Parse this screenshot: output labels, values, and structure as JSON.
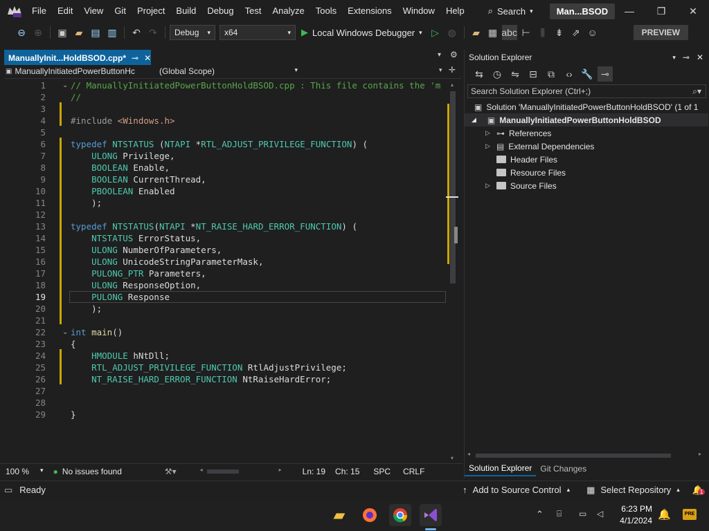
{
  "menubar": {
    "items": [
      "File",
      "Edit",
      "View",
      "Git",
      "Project",
      "Build",
      "Debug",
      "Test",
      "Analyze",
      "Tools",
      "Extensions",
      "Window",
      "Help"
    ],
    "search_label": "Search",
    "title": "Man...BSOD"
  },
  "toolbar": {
    "config": "Debug",
    "platform": "x64",
    "run_label": "Local Windows Debugger",
    "preview_label": "PREVIEW"
  },
  "editor_tab": {
    "filename": "ManuallyInit...HoldBSOD.cpp*"
  },
  "navbar": {
    "project": "ManuallyInitiatedPowerButtonHc",
    "scope": "(Global Scope)"
  },
  "code": {
    "current_line": 19,
    "lines": [
      {
        "n": "1",
        "t": "// ManuallyInitiatedPowerButtonHoldBSOD.cpp : This file contains the 'm"
      },
      {
        "n": "2",
        "t": "//"
      },
      {
        "n": "3",
        "t": ""
      },
      {
        "n": "4",
        "t": "#include <Windows.h>"
      },
      {
        "n": "5",
        "t": ""
      },
      {
        "n": "6",
        "t": "typedef NTSTATUS (NTAPI *RTL_ADJUST_PRIVILEGE_FUNCTION) ("
      },
      {
        "n": "7",
        "t": "    ULONG Privilege,"
      },
      {
        "n": "8",
        "t": "    BOOLEAN Enable,"
      },
      {
        "n": "9",
        "t": "    BOOLEAN CurrentThread,"
      },
      {
        "n": "10",
        "t": "    PBOOLEAN Enabled"
      },
      {
        "n": "11",
        "t": "    );"
      },
      {
        "n": "12",
        "t": ""
      },
      {
        "n": "13",
        "t": "typedef NTSTATUS(NTAPI *NT_RAISE_HARD_ERROR_FUNCTION) ("
      },
      {
        "n": "14",
        "t": "    NTSTATUS ErrorStatus,"
      },
      {
        "n": "15",
        "t": "    ULONG NumberOfParameters,"
      },
      {
        "n": "16",
        "t": "    ULONG UnicodeStringParameterMask,"
      },
      {
        "n": "17",
        "t": "    PULONG_PTR Parameters,"
      },
      {
        "n": "18",
        "t": "    ULONG ResponseOption,"
      },
      {
        "n": "19",
        "t": "    PULONG Response"
      },
      {
        "n": "20",
        "t": "    );"
      },
      {
        "n": "21",
        "t": ""
      },
      {
        "n": "22",
        "t": "int main()"
      },
      {
        "n": "23",
        "t": "{"
      },
      {
        "n": "24",
        "t": "    HMODULE hNtDll;"
      },
      {
        "n": "25",
        "t": "    RTL_ADJUST_PRIVILEGE_FUNCTION RtlAdjustPrivilege;"
      },
      {
        "n": "26",
        "t": "    NT_RAISE_HARD_ERROR_FUNCTION NtRaiseHardError;"
      },
      {
        "n": "27",
        "t": ""
      },
      {
        "n": "28",
        "t": ""
      },
      {
        "n": "29",
        "t": "}"
      }
    ]
  },
  "editor_status": {
    "zoom": "100 %",
    "issues": "No issues found",
    "line": "Ln: 19",
    "col": "Ch: 15",
    "spacing": "SPC",
    "eol": "CRLF"
  },
  "solution_explorer": {
    "title": "Solution Explorer",
    "search_placeholder": "Search Solution Explorer (Ctrl+;)",
    "solution": "Solution 'ManuallyInitiatedPowerButtonHoldBSOD' (1 of 1",
    "project": "ManuallyInitiatedPowerButtonHoldBSOD",
    "items": [
      "References",
      "External Dependencies",
      "Header Files",
      "Resource Files",
      "Source Files"
    ],
    "tabs": [
      "Solution Explorer",
      "Git Changes"
    ]
  },
  "statusbar": {
    "ready": "Ready",
    "add_source": "Add to Source Control",
    "select_repo": "Select Repository",
    "notifications": "1"
  },
  "taskbar": {
    "time": "6:23 PM",
    "date": "4/1/2024"
  },
  "colors": {
    "accent": "#0e639c",
    "keyword": "#569cd6",
    "type": "#4ec9b0",
    "comment": "#57a64a",
    "string": "#d69d85",
    "change_marker": "#c8a800"
  }
}
